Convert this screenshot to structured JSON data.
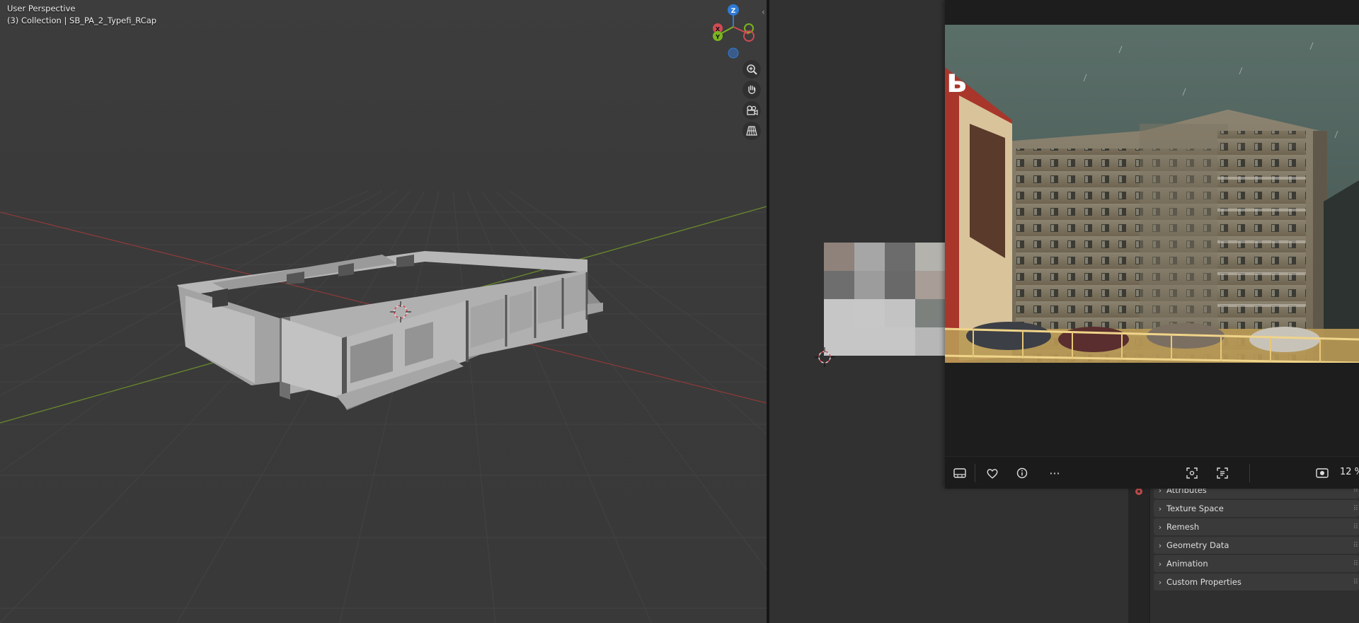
{
  "viewport": {
    "title": "User Perspective",
    "subtitle": "(3) Collection | SB_PA_2_Typefi_RCap",
    "gizmo": {
      "z_label": "Z",
      "x_label": "X",
      "y_label": "Y"
    },
    "nav_icons": [
      "zoom-in-icon",
      "hand-pan-icon",
      "camera-icon",
      "grid-perspective-icon"
    ]
  },
  "properties": {
    "sections": [
      "Attributes",
      "Texture Space",
      "Remesh",
      "Geometry Data",
      "Animation",
      "Custom Properties"
    ]
  },
  "viewer": {
    "photo_sign_text": "ь",
    "toolbar_icons": [
      "filmstrip-icon",
      "heart-icon",
      "info-icon",
      "more-icon",
      "scan-icon",
      "text-scan-icon",
      "screen-capture-icon"
    ],
    "more_label": "···",
    "zoom": "12 %"
  },
  "colors": {
    "gizmo_z": "#2f7bd6",
    "gizmo_x": "#d04a55",
    "gizmo_y": "#7ab320",
    "axis_red": "#8a3a3a",
    "axis_green": "#6a8a2c"
  }
}
